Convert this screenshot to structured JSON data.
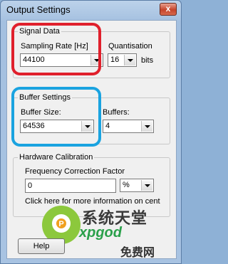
{
  "window": {
    "title": "Output Settings",
    "close_label": "x"
  },
  "signal": {
    "group_label": "Signal Data",
    "sampling_label": "Sampling Rate [Hz]",
    "sampling_value": "44100",
    "quant_label": "Quantisation",
    "quant_value": "16",
    "quant_unit": "bits"
  },
  "buffer": {
    "group_label": "Buffer Settings",
    "size_label": "Buffer Size:",
    "size_value": "64536",
    "count_label": "Buffers:",
    "count_value": "4"
  },
  "calibration": {
    "group_label": "Hardware Calibration",
    "factor_label": "Frequency Correction Factor",
    "factor_value": "0",
    "unit_value": "%",
    "info_text": "Click here for more information on cent"
  },
  "buttons": {
    "help_label": "Help"
  },
  "watermark": {
    "text": "系统天堂",
    "url": "xpgod",
    "sub": "免费网"
  },
  "colors": {
    "highlight_red": "#e0202c",
    "highlight_blue": "#1aa3e0"
  }
}
